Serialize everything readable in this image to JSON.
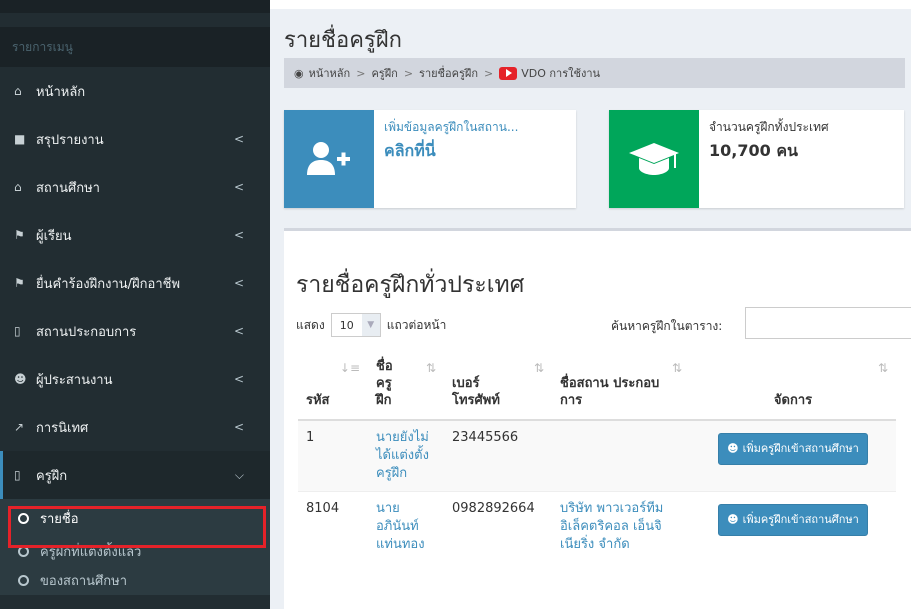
{
  "sidebar": {
    "header": "รายการเมนู",
    "items": [
      {
        "icon": "home-icon",
        "glyph": "⌂",
        "label": "หน้าหลัก",
        "chevron": ""
      },
      {
        "icon": "book-icon",
        "glyph": "■",
        "label": "สรุปรายงาน",
        "chevron": "<"
      },
      {
        "icon": "institution-icon",
        "glyph": "⌂",
        "label": "สถานศึกษา",
        "chevron": "<"
      },
      {
        "icon": "graduation-cap-icon",
        "glyph": "⚑",
        "label": "ผู้เรียน",
        "chevron": "<"
      },
      {
        "icon": "graduation-cap-icon",
        "glyph": "⚑",
        "label": "ยื่นคำร้องฝึกงาน/ฝึกอาชีพ",
        "chevron": "<"
      },
      {
        "icon": "building-icon",
        "glyph": "▯",
        "label": "สถานประกอบการ",
        "chevron": "<"
      },
      {
        "icon": "users-icon",
        "glyph": "☻",
        "label": "ผู้ประสานงาน",
        "chevron": "<"
      },
      {
        "icon": "line-chart-icon",
        "glyph": "↗",
        "label": "การนิเทศ",
        "chevron": "<"
      },
      {
        "icon": "building-icon",
        "glyph": "▯",
        "label": "ครูฝึก",
        "chevron": "⌵"
      }
    ],
    "subitems": [
      "รายชื่อ",
      "ครูฝึกที่แต่งตั้งแล้ว",
      "ของสถานศึกษา"
    ]
  },
  "page": {
    "title": "รายชื่อครูฝึก",
    "breadcrumb": [
      "หน้าหลัก",
      "ครูฝึก",
      "รายชื่อครูฝึก",
      "VDO การใช้งาน"
    ],
    "breadcrumb_sep": ">"
  },
  "infoboxes": [
    {
      "line1": "เพิ่มข้อมูลครูฝึกในสถาน...",
      "line2": "คลิกที่นี่",
      "color": "#3c8dbc"
    },
    {
      "line1": "จำนวนครูฝึกทั้งประเทศ",
      "line2": "10,700 คน",
      "color": "#00a65a"
    }
  ],
  "panel": {
    "title": "รายชื่อครูฝึกทั่วประเทศ",
    "show_label": "แสดง",
    "page_size": "10",
    "rows_label": "แถวต่อหน้า",
    "search_label": "ค้นหาครูฝึกในตาราง:",
    "search_value": ""
  },
  "table": {
    "headers": [
      "รหัส",
      "ชื่อ ครู ฝึก",
      "เบอร์ โทรศัพท์",
      "ชื่อสถาน ประกอบการ",
      "จัดการ"
    ],
    "rows": [
      {
        "id": "1",
        "name": "นายยังไม่ได้แต่งตั้งครูฝึก",
        "phone": "23445566",
        "company": "",
        "action": "เพิ่มครูฝึกเข้าสถานศึกษา"
      },
      {
        "id": "8104",
        "name": "นาย อภินันท์ แท่นทอง",
        "phone": "0982892664",
        "company": "บริษัท พาวเวอร์ทีม อิเล็คตริคอล เอ็นจิเนียริ่ง จำกัด",
        "action": "เพิ่มครูฝึกเข้าสถานศึกษา"
      }
    ]
  }
}
